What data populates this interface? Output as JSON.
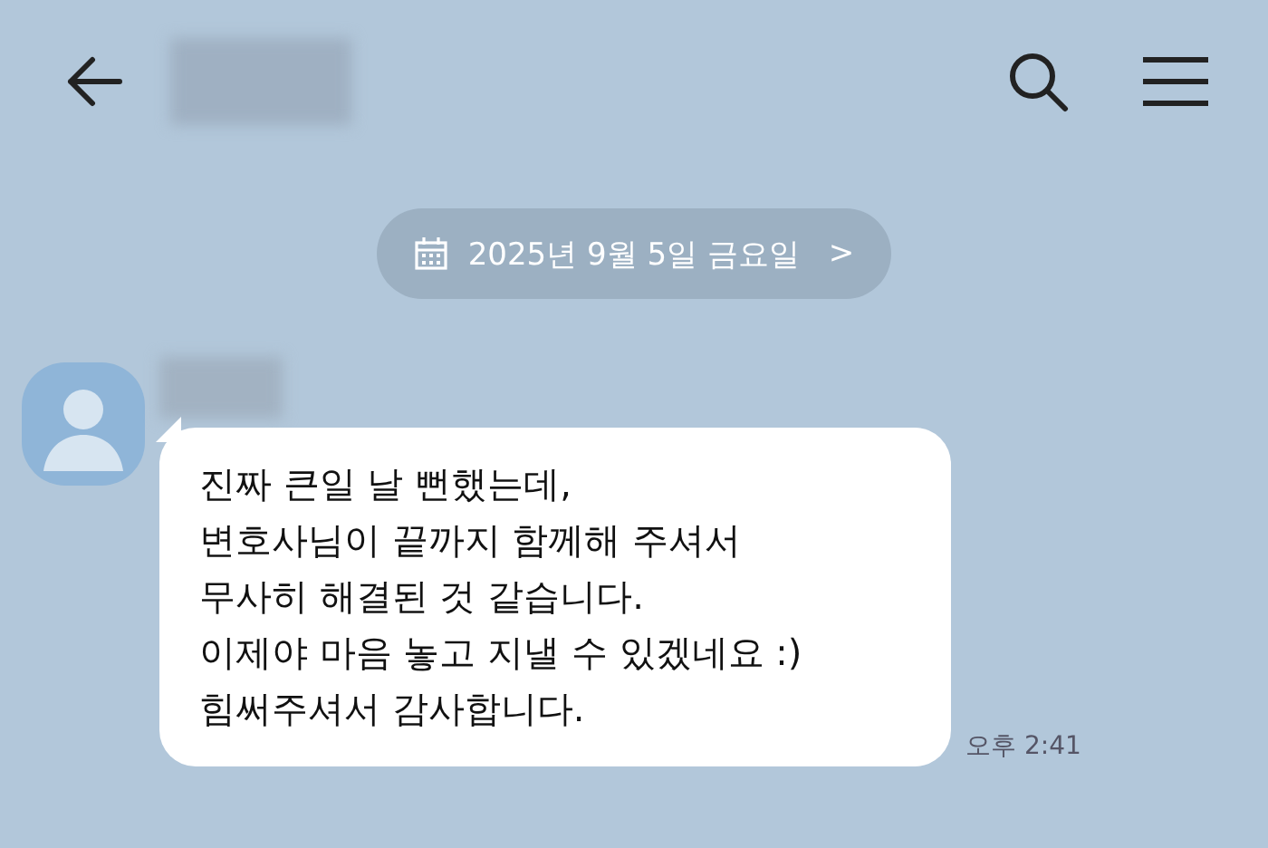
{
  "date_divider": {
    "label": "2025년 9월 5일 금요일",
    "chevron": ">"
  },
  "messages": [
    {
      "kind": "received",
      "text": "진짜 큰일 날 뻔했는데,\n변호사님이 끝까지 함께해 주셔서\n무사히 해결된 것 같습니다.\n이제야 마음 놓고 지낼 수 있겠네요 :)\n힘써주셔서 감사합니다.",
      "time": "오후 2:41"
    }
  ]
}
